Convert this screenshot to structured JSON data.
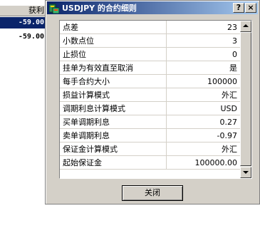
{
  "background_table": {
    "header": "获利",
    "rows": [
      {
        "value": "-59.00",
        "selected": true
      },
      {
        "value": "-59.00",
        "selected": false
      }
    ]
  },
  "dialog": {
    "title": "USDJPY 的合约细则",
    "help_label": "?",
    "close_x_label": "×",
    "close_button_label": "关闭",
    "properties": [
      {
        "label": "点差",
        "value": "23"
      },
      {
        "label": "小数点位",
        "value": "3"
      },
      {
        "label": "止损位",
        "value": "0"
      },
      {
        "label": "挂单为有效直至取消",
        "value": "是"
      },
      {
        "label": "每手合约大小",
        "value": "100000"
      },
      {
        "label": "损益计算模式",
        "value": "外汇"
      },
      {
        "label": "调期利息计算模式",
        "value": "USD"
      },
      {
        "label": "买单调期利息",
        "value": "0.27"
      },
      {
        "label": "卖单调期利息",
        "value": "-0.97"
      },
      {
        "label": "保证金计算模式",
        "value": "外汇"
      },
      {
        "label": "起始保证金",
        "value": "100000.00"
      }
    ]
  },
  "colors": {
    "title_gradient_start": "#0a246a",
    "title_gradient_end": "#a6caf0",
    "selection": "#0a246a",
    "face": "#d4d0c8"
  }
}
